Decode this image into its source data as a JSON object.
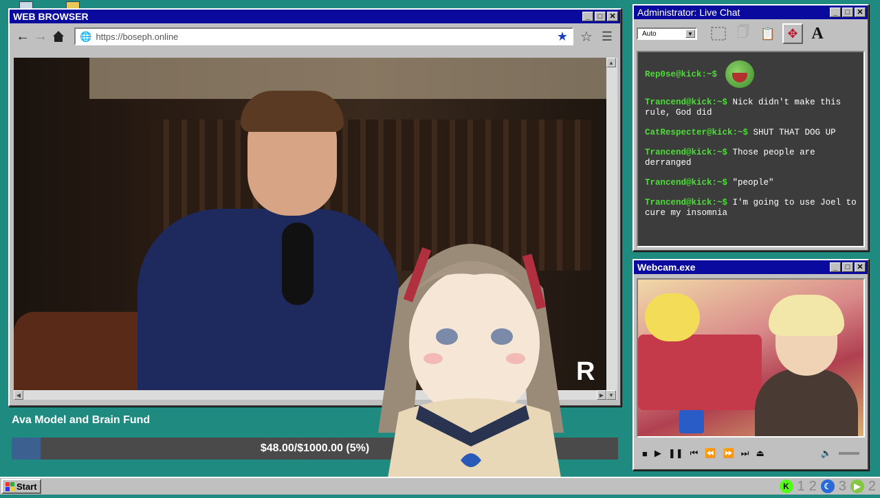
{
  "browser": {
    "title": "WEB BROWSER",
    "url": "https://boseph.online",
    "back_icon": "arrow-left-icon",
    "forward_icon": "arrow-right-icon",
    "home_icon": "home-icon"
  },
  "video": {
    "watermark": "R"
  },
  "chat": {
    "title": "Administrator: Live Chat",
    "font_select": "Auto",
    "messages": [
      {
        "user": "Rep0se@kick:~$",
        "text": ""
      },
      {
        "user": "Trancend@kick:~$",
        "text": "Nick didn't make this rule, God did"
      },
      {
        "user": "CatRespecter@kick:~$",
        "text": "SHUT THAT DOG UP"
      },
      {
        "user": "Trancend@kick:~$",
        "text": "Those people are derranged"
      },
      {
        "user": "Trancend@kick:~$",
        "text": "\"people\""
      },
      {
        "user": "Trancend@kick:~$",
        "text": "I'm going to use Joel to cure my insomnia"
      }
    ]
  },
  "webcam": {
    "title": "Webcam.exe"
  },
  "fund": {
    "title": "Ava Model and Brain Fund",
    "progress_text": "$48.00/$1000.00 (5%)",
    "progress_fraction": 0.048
  },
  "taskbar": {
    "start_label": "Start",
    "tray_numbers": [
      "1",
      "2",
      "3",
      "2"
    ]
  },
  "colors": {
    "desktop": "#1f8a80",
    "titlebar": "#0a0a9e",
    "chat_user": "#4fdc3a",
    "fund_fill": "#3c6190"
  }
}
